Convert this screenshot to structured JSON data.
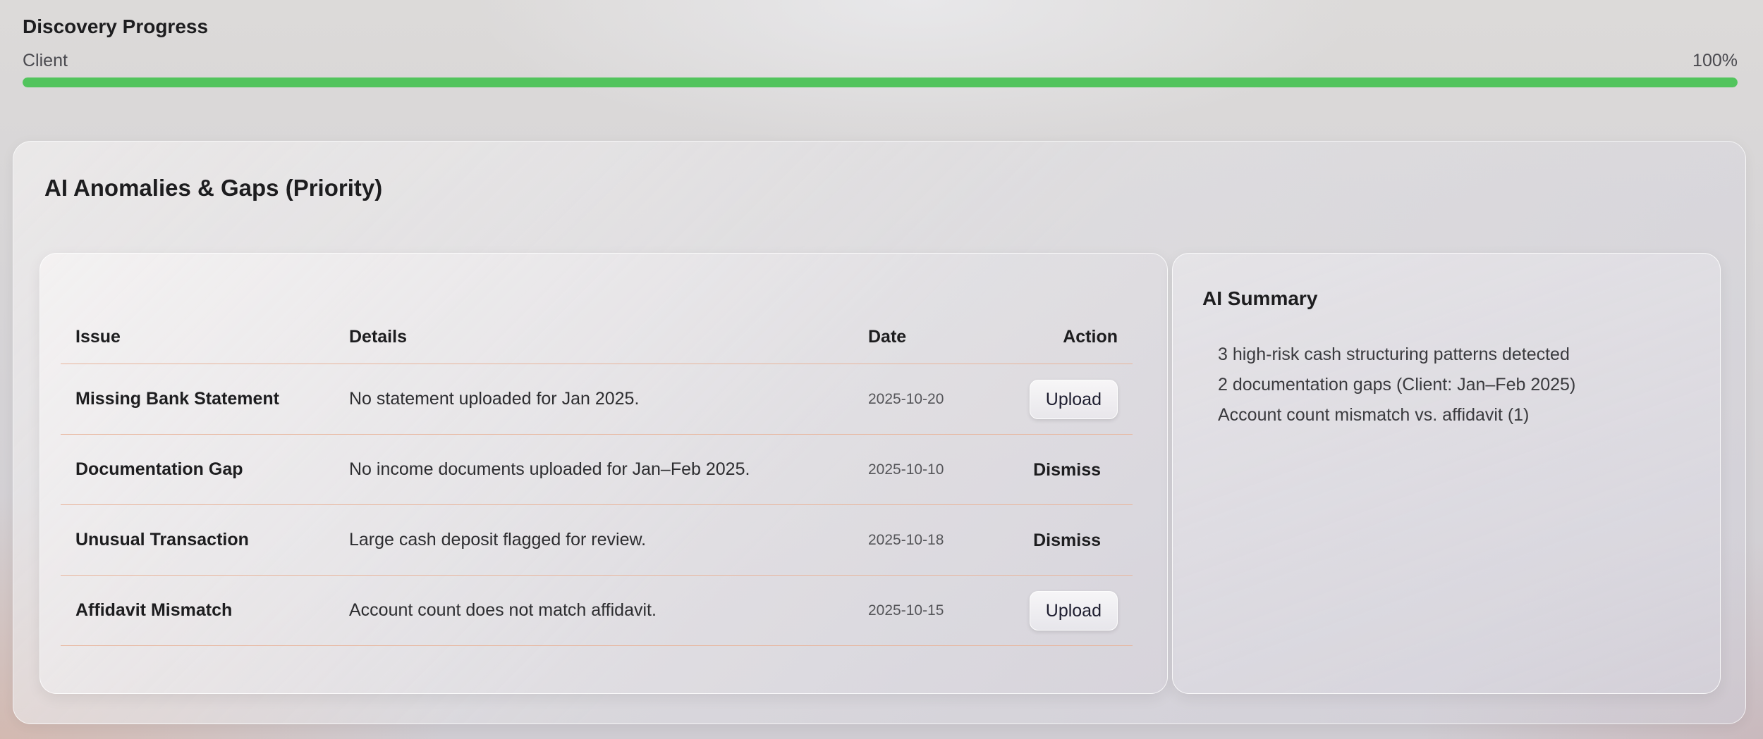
{
  "progress": {
    "title": "Discovery Progress",
    "label": "Client",
    "percent_text": "100%",
    "value": 1.0,
    "bar_color": "#52c45d"
  },
  "anomalies": {
    "title": "AI Anomalies & Gaps (Priority)",
    "columns": {
      "issue": "Issue",
      "details": "Details",
      "date": "Date",
      "action": "Action"
    },
    "rows": [
      {
        "issue": "Missing Bank Statement",
        "details": "No statement uploaded for Jan 2025.",
        "date": "2025-10-20",
        "action": "Upload"
      },
      {
        "issue": "Documentation Gap",
        "details": "No income documents uploaded for Jan–Feb 2025.",
        "date": "2025-10-10",
        "action": "Dismiss"
      },
      {
        "issue": "Unusual Transaction",
        "details": "Large cash deposit flagged for review.",
        "date": "2025-10-18",
        "action": "Dismiss"
      },
      {
        "issue": "Affidavit Mismatch",
        "details": "Account count does not match affidavit.",
        "date": "2025-10-15",
        "action": "Upload"
      }
    ]
  },
  "summary": {
    "title": "AI Summary",
    "items": [
      "3 high-risk cash structuring patterns detected",
      "2 documentation gaps (Client: Jan–Feb 2025)",
      "Account count mismatch vs. affidavit (1)"
    ]
  }
}
